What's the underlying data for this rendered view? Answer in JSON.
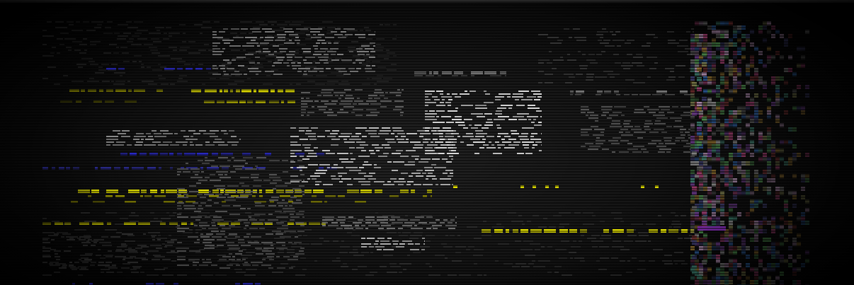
{
  "screen": {
    "background": "#1c1c1c",
    "accent_yellow": "#e4e000",
    "accent_blue": "#2a2ad0",
    "ansi_art_gray": "#b8b8b8"
  }
}
